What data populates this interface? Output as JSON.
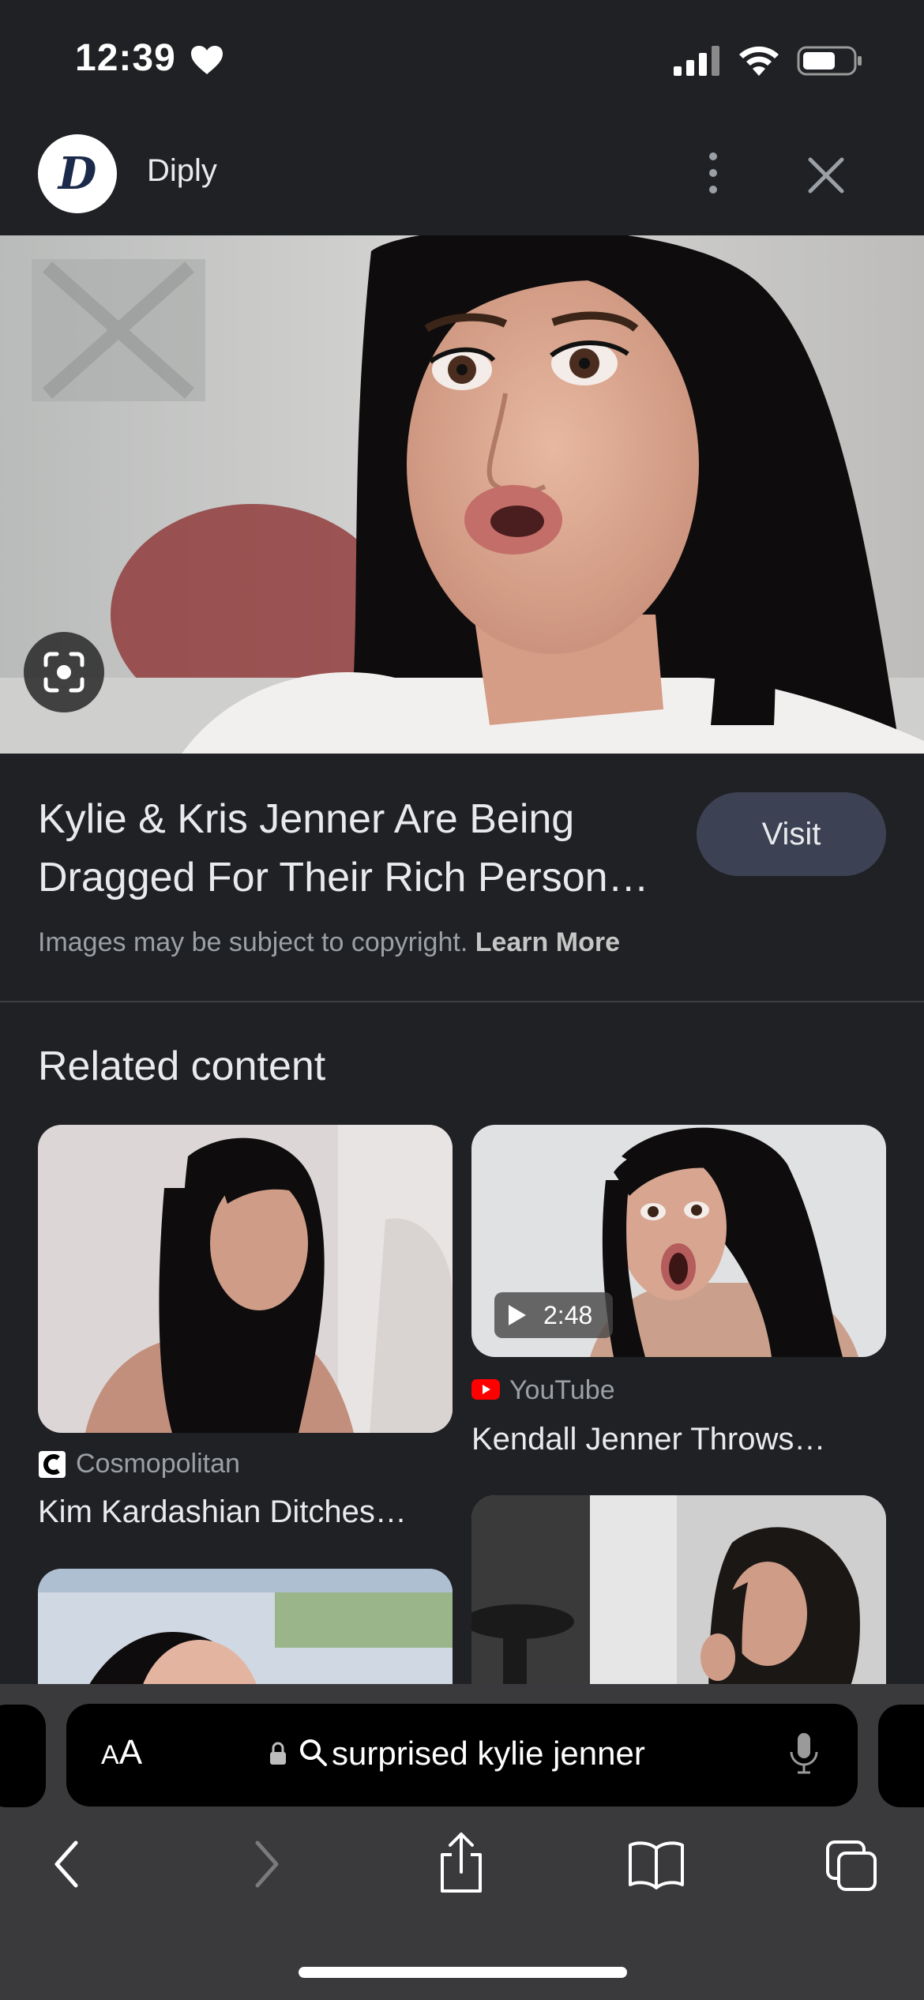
{
  "status_bar": {
    "time": "12:39"
  },
  "header": {
    "logo_letter": "D",
    "site_name": "Diply"
  },
  "result": {
    "title_line1": "Kylie & Kris Jenner Are Being",
    "title_line2": "Dragged For Their Rich Person…",
    "visit_label": "Visit",
    "copyright_text": "Images may be subject to copyright.",
    "learn_more_label": "Learn More"
  },
  "related": {
    "heading": "Related content",
    "cards": [
      {
        "source": "Cosmopolitan",
        "title": "Kim Kardashian Ditches…",
        "icon": "cosmopolitan-icon"
      },
      {
        "source": "YouTube",
        "title": "Kendall Jenner Throws…",
        "icon": "youtube-icon",
        "duration": "2:48"
      }
    ]
  },
  "address_bar": {
    "aa_small": "A",
    "aa_large": "A",
    "query": "surprised kylie jenner"
  },
  "colors": {
    "background": "#202124",
    "visit_button": "#3c4253",
    "toolbar": "#3a3a3c",
    "youtube_red": "#ff0000"
  }
}
